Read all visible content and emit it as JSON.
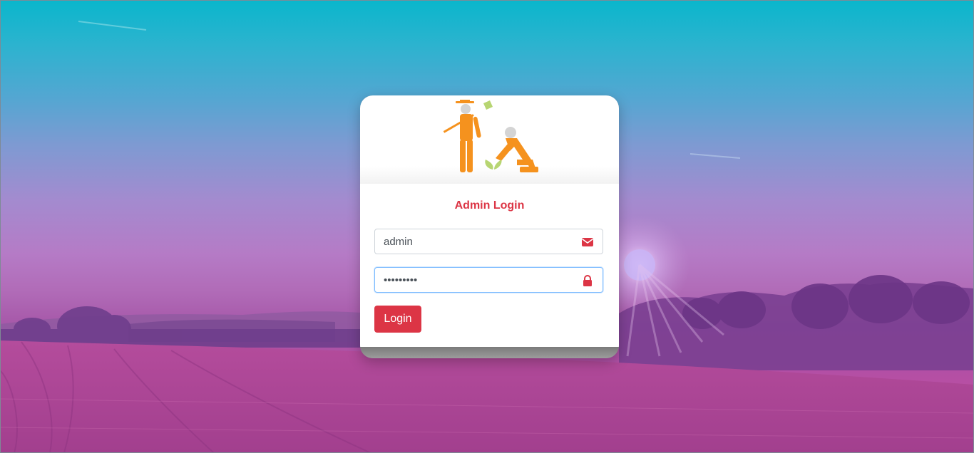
{
  "page": {
    "accent_color": "#dc3545"
  },
  "login": {
    "title": "Admin Login",
    "username_value": "admin",
    "password_value": "password1",
    "submit_label": "Login"
  },
  "icons": {
    "username_icon": "envelope-icon",
    "password_icon": "lock-icon",
    "logo": "farmer-logo"
  }
}
